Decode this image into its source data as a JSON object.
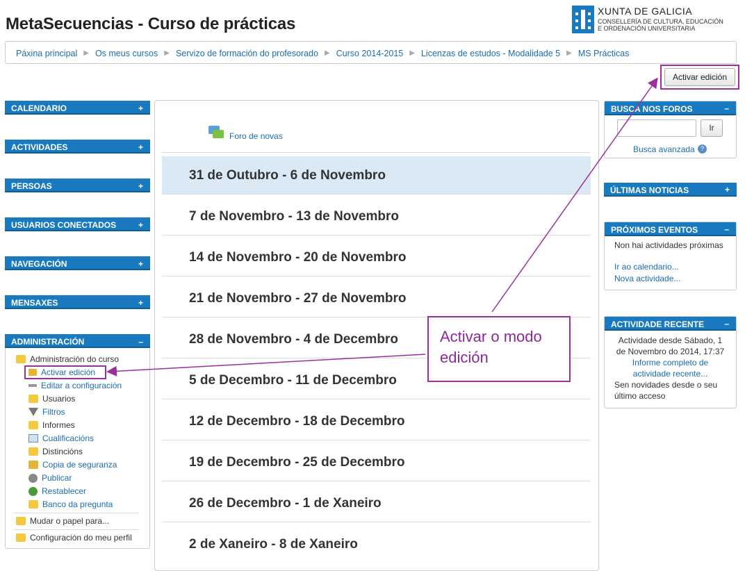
{
  "page": {
    "title": "MetaSecuencias - Curso de prácticas"
  },
  "logo": {
    "title": "XUNTA DE GALICIA",
    "sub1": "CONSELLERÍA DE CULTURA, EDUCACIÓN",
    "sub2": "E ORDENACIÓN UNIVERSITARIA"
  },
  "breadcrumb": [
    "Páxina principal",
    "Os meus cursos",
    "Servizo de formación do profesorado",
    "Curso 2014-2015",
    "Licenzas de estudos - Modalidade 5",
    "MS Prácticas"
  ],
  "toolbar": {
    "edit_label": "Activar edición"
  },
  "left_blocks": [
    "CALENDARIO",
    "ACTIVIDADES",
    "PERSOAS",
    "USUARIOS CONECTADOS",
    "NAVEGACIÓN",
    "MENSAXES"
  ],
  "admin": {
    "title": "ADMINISTRACIÓN",
    "course_admin": "Administración do curso",
    "items": [
      "Activar edición",
      "Editar a configuración",
      "Usuarios",
      "Filtros",
      "Informes",
      "Cualificacións",
      "Distincións",
      "Copia de seguranza",
      "Publicar",
      "Restablecer",
      "Banco da pregunta"
    ],
    "switch_role": "Mudar o papel para...",
    "profile": "Configuración do meu perfil"
  },
  "center": {
    "forum": "Foro de novas",
    "weeks": [
      "31 de Outubro - 6 de Novembro",
      "7 de Novembro - 13 de Novembro",
      "14 de Novembro - 20 de Novembro",
      "21 de Novembro - 27 de Novembro",
      "28 de Novembro - 4 de Decembro",
      "5 de Decembro - 11 de Decembro",
      "12 de Decembro - 18 de Decembro",
      "19 de Decembro - 25 de Decembro",
      "26 de Decembro - 1 de Xaneiro",
      "2 de Xaneiro - 8 de Xaneiro"
    ]
  },
  "search": {
    "title": "BUSCA NOS FOROS",
    "button": "Ir",
    "advanced": "Busca avanzada"
  },
  "news": {
    "title": "ÚLTIMAS NOTICIAS"
  },
  "events": {
    "title": "PRÓXIMOS EVENTOS",
    "none": "Non hai actividades próximas",
    "calendar": "Ir ao calendario...",
    "new": "Nova actividade..."
  },
  "recent": {
    "title": "ACTIVIDADE RECENTE",
    "since1": "Actividade desde Sábado, 1",
    "since2": "de Novembro do 2014, 17:37",
    "report1": "Informe completo de",
    "report2": "actividade recente...",
    "nonews1": "Sen novidades desde o seu",
    "nonews2": "último acceso"
  },
  "callout": {
    "line1": "Activar o modo",
    "line2": "edición"
  },
  "colors": {
    "accent": "#1a7abf",
    "annotation": "#9b2f9b"
  }
}
